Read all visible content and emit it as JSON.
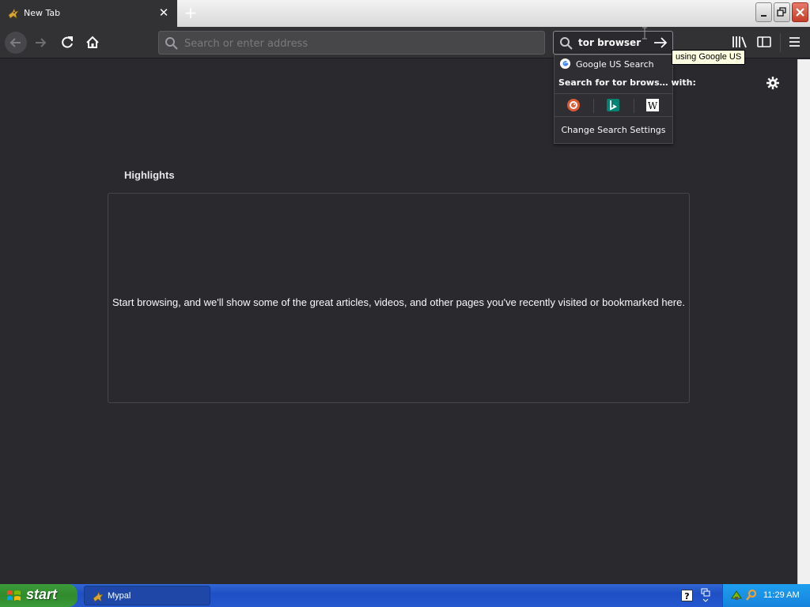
{
  "tab": {
    "title": "New Tab",
    "favicon": "mypal-icon",
    "close_glyph": "✕"
  },
  "new_tab_glyph": "+",
  "toolbar": {
    "url_placeholder": "Search or enter address",
    "search_value": "tor browser"
  },
  "search_popup": {
    "default_engine": "Google US Search",
    "search_for": "Search for tor brows… with:",
    "engines": [
      "duckduckgo-icon",
      "bing-icon",
      "wikipedia-icon"
    ],
    "settings": "Change Search Settings"
  },
  "tooltip": "using Google US",
  "content": {
    "highlights_title": "Highlights",
    "highlights_message": "Start browsing, and we'll show some of the great articles, videos, and other pages you've recently visited or bookmarked here."
  },
  "taskbar": {
    "start_label": "start",
    "window_item": "Mypal",
    "clock": "11:29 AM"
  },
  "colors": {
    "content_bg": "#2a2a2e",
    "toolbar_bg": "#323234",
    "taskbar_blue": "#245edb",
    "start_green": "#3c9b3a",
    "close_red": "#c33e2a"
  }
}
